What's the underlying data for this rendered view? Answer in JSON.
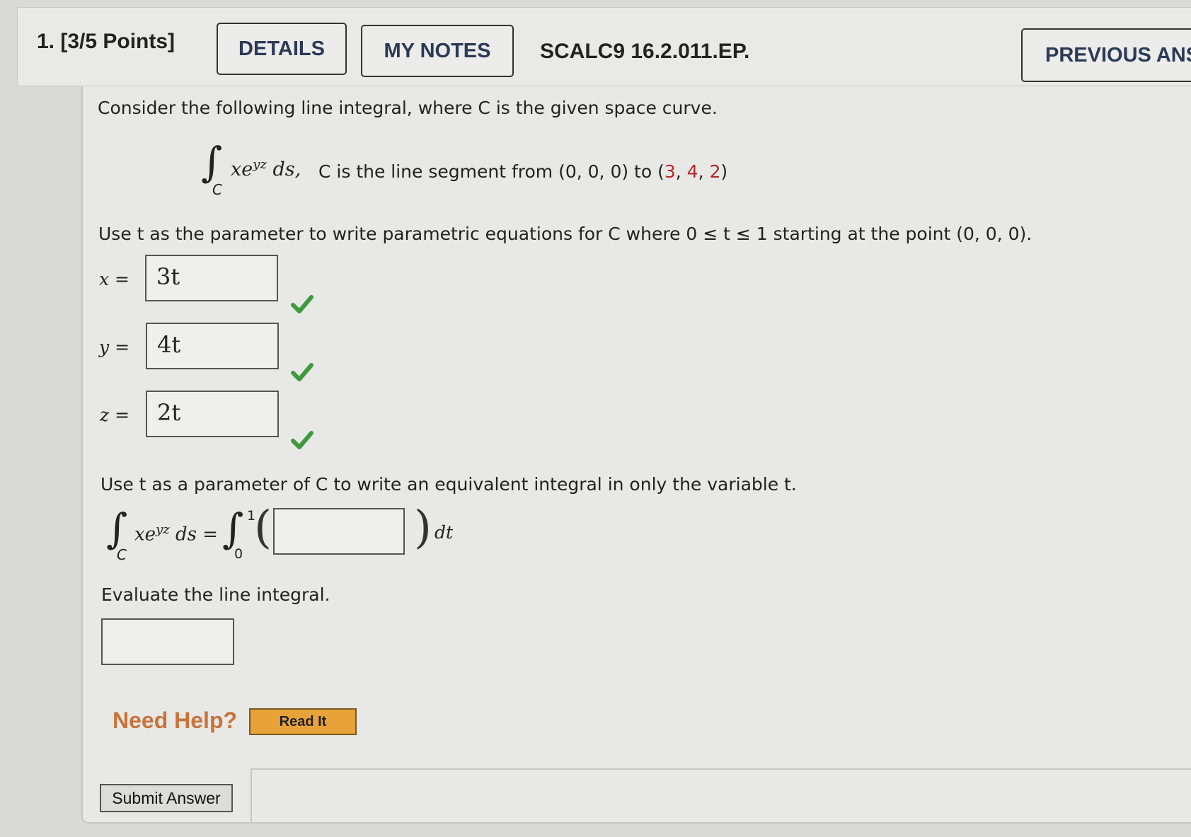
{
  "header": {
    "question_label": "1.  [3/5 Points]",
    "details_label": "DETAILS",
    "my_notes_label": "MY NOTES",
    "problem_code": "SCALC9 16.2.011.EP.",
    "previous_answers_label": "PREVIOUS ANS"
  },
  "problem": {
    "intro": "Consider the following line integral, where C is the given space curve.",
    "integrand": "xe",
    "exponent": "yz",
    "ds": "ds,",
    "sub_c": "C",
    "curve_desc_pre": "C is the line segment from (0, 0, 0) to (",
    "curve_x": "3",
    "curve_sep1": ", ",
    "curve_y": "4",
    "curve_sep2": ", ",
    "curve_z": "2",
    "curve_close": ")",
    "param_instruction": "Use t as the parameter to write parametric equations for C where 0 ≤ t ≤ 1 starting at the point (0, 0, 0).",
    "equiv_instruction": "Use t as a parameter of C to write an equivalent integral in only the variable t.",
    "lhs_ds": "ds =",
    "upper_limit": "1",
    "lower_limit": "0",
    "dt": "dt",
    "evaluate_instruction": "Evaluate the line integral."
  },
  "answers": {
    "x_label": "x  =",
    "x_value": "3t",
    "y_label": "y  =",
    "y_value": "4t",
    "z_label": "z  =",
    "z_value": "2t",
    "integrand_value": "",
    "final_value": ""
  },
  "status": {
    "check_color": "#3d9a3d"
  },
  "help": {
    "need_help_label": "Need Help?",
    "read_it_label": "Read It"
  },
  "submit_label": "Submit Answer"
}
